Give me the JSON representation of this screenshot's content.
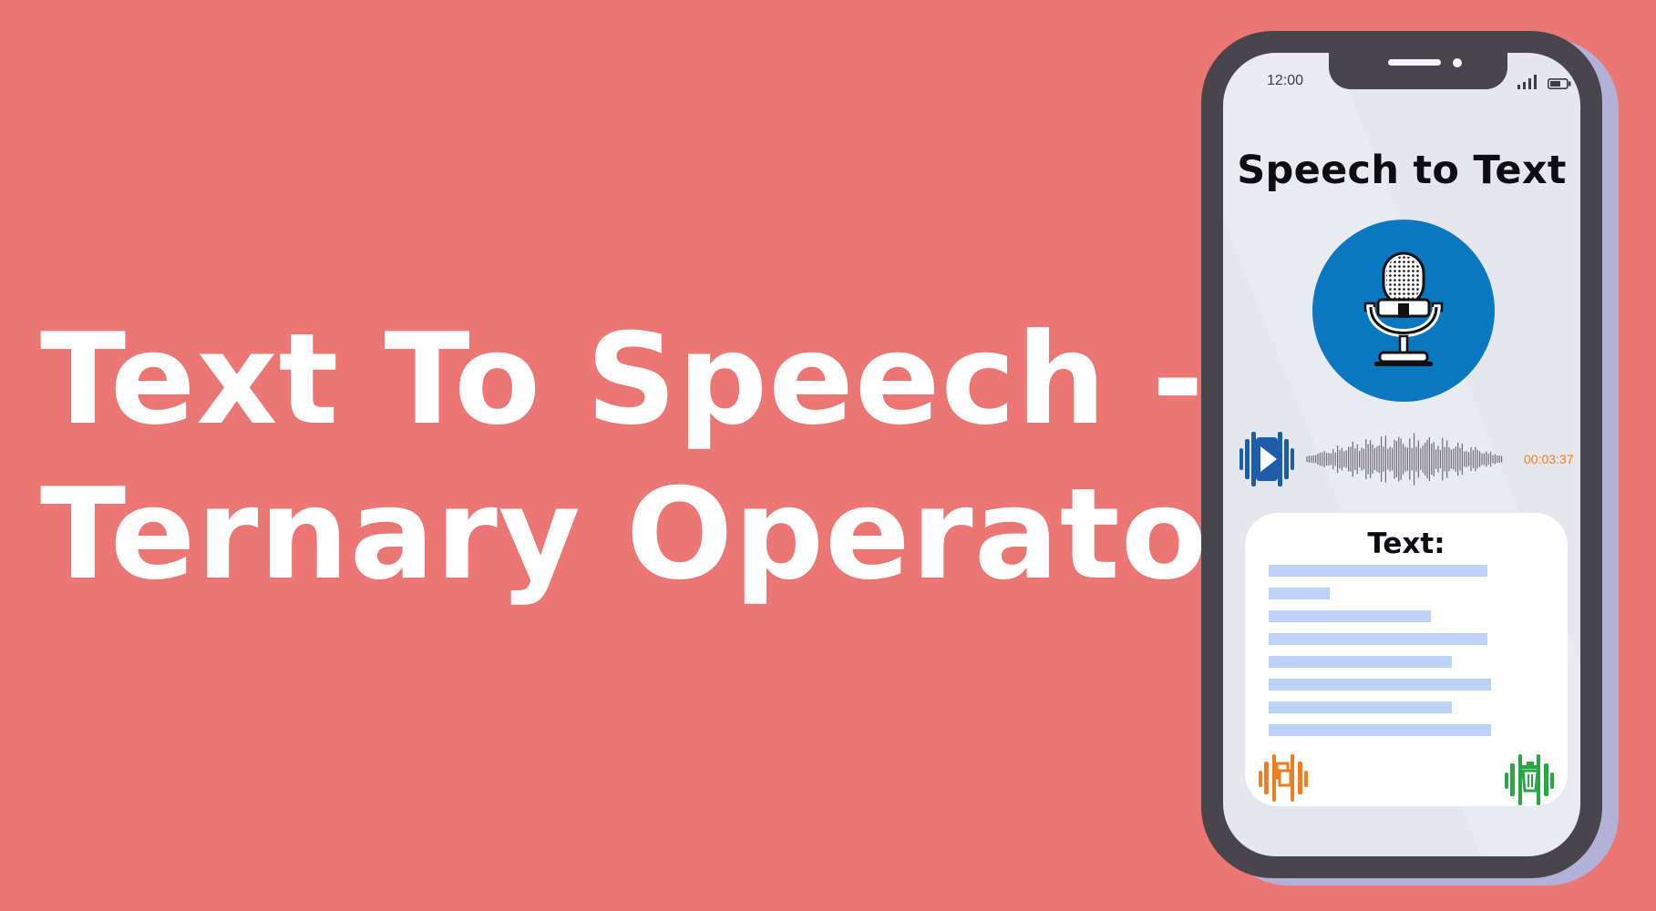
{
  "headline": {
    "line1": "Text To Speech -",
    "line2": "Ternary Operator"
  },
  "phone": {
    "status_bar": {
      "time": "12:00",
      "icons": [
        "signal-icon",
        "battery-icon"
      ]
    },
    "app_title": "Speech to Text",
    "mic_button": {
      "icon": "microphone-icon",
      "color": "#0a78c1"
    },
    "player": {
      "play_icon": "play-icon",
      "duration": "00:03:37",
      "duration_color": "#f07d1f",
      "play_color": "#1e5ea8"
    },
    "text_card": {
      "label": "Text:",
      "placeholder_line_color": "#bcd2f7",
      "copy_icon": "copy-icon",
      "copy_color": "#f07d1f",
      "delete_icon": "trash-icon",
      "delete_color": "#28a745"
    }
  },
  "colors": {
    "background": "#ec7673",
    "phone_frame": "#48464c",
    "screen": "#e5e6ee"
  }
}
